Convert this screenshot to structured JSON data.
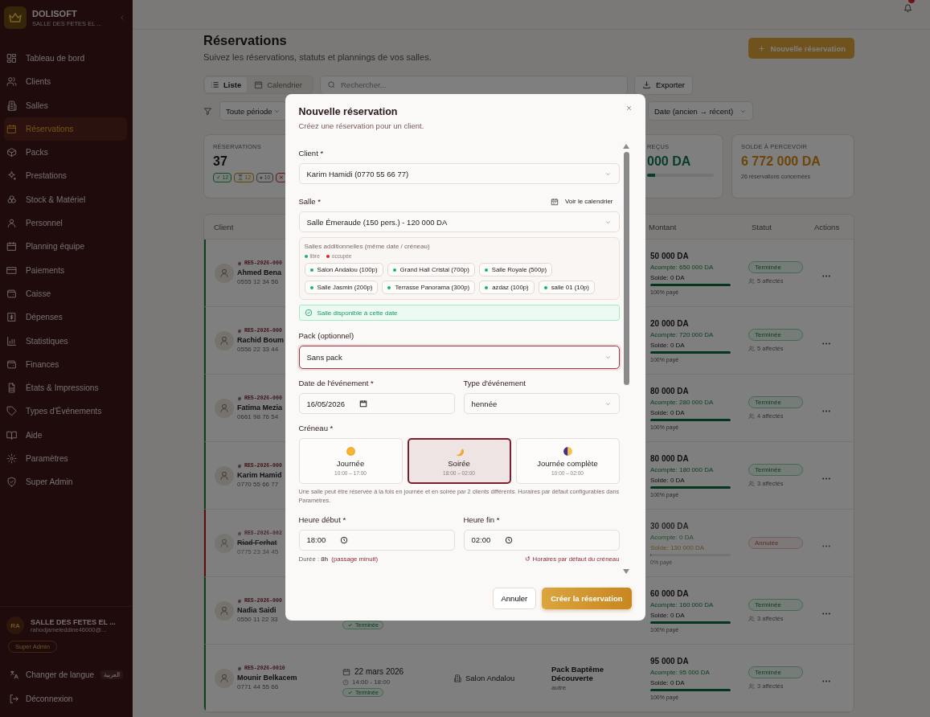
{
  "sidebar": {
    "brand": "DOLISOFT",
    "venue": "SALLE DES FETES EL ...",
    "items": [
      {
        "label": "Tableau de bord",
        "selected": false
      },
      {
        "label": "Clients",
        "selected": false
      },
      {
        "label": "Salles",
        "selected": false
      },
      {
        "label": "Réservations",
        "selected": true
      },
      {
        "label": "Packs",
        "selected": false
      },
      {
        "label": "Prestations",
        "selected": false
      },
      {
        "label": "Stock & Matériel",
        "selected": false
      },
      {
        "label": "Personnel",
        "selected": false
      },
      {
        "label": "Planning équipe",
        "selected": false
      },
      {
        "label": "Paiements",
        "selected": false
      },
      {
        "label": "Caisse",
        "selected": false
      },
      {
        "label": "Dépenses",
        "selected": false
      },
      {
        "label": "Statistiques",
        "selected": false
      },
      {
        "label": "Finances",
        "selected": false
      },
      {
        "label": "États & Impressions",
        "selected": false
      },
      {
        "label": "Types d'Événements",
        "selected": false
      },
      {
        "label": "Aide",
        "selected": false
      },
      {
        "label": "Paramètres",
        "selected": false
      },
      {
        "label": "Super Admin",
        "selected": false
      }
    ],
    "user": {
      "initials": "RA",
      "name": "SALLE DES FETES EL ...",
      "email": "rahodjameleddine46000@...",
      "role": "Super Admin"
    },
    "language": {
      "label": "Changer de langue",
      "value": "العربية"
    },
    "logout": "Déconnexion"
  },
  "topbar": {
    "unread": true
  },
  "page": {
    "title": "Réservations",
    "subtitle": "Suivez les réservations, statuts et plannings de vos salles.",
    "new_button": "Nouvelle réservation"
  },
  "view_tabs": [
    {
      "label": "Liste",
      "selected": true
    },
    {
      "label": "Calendrier",
      "selected": false
    }
  ],
  "search": {
    "placeholder": "Rechercher..."
  },
  "export": "Exporter",
  "filters": [
    "Toute période",
    "Date (ancien → récent)"
  ],
  "stats": [
    {
      "kind": "count",
      "label": "RÉSERVATIONS",
      "value": "37",
      "chips": [
        {
          "text": "✓ 12",
          "kind": "done"
        },
        {
          "text": "⌛ 12",
          "kind": "pending"
        },
        {
          "text": "● 10",
          "kind": "other"
        },
        {
          "text": "✕",
          "kind": "cancelled"
        }
      ]
    },
    {
      "kind": "money",
      "label": "REÇUS",
      "value": "000 DA",
      "level": 0.12
    },
    {
      "kind": "balance",
      "label": "SOLDE À PERCEVOIR",
      "value": "6 772 000 DA",
      "note": "26 réservations concernées"
    }
  ],
  "table": {
    "columns": [
      "Client",
      "Montant",
      "Statut",
      "Actions"
    ],
    "rows": [
      {
        "ref": "RES-2026-000",
        "name": "Ahmed Bena",
        "phone": "0555 12 34 56",
        "amount": "50 000 DA",
        "deposit": "Acompte: 650 000 DA",
        "balance": "Solde: 0 DA",
        "level": 1,
        "paid": "100% payé",
        "status": "Terminée",
        "staff": "5 affectés",
        "cancelled": false
      },
      {
        "ref": "RES-2026-000",
        "name": "Rachid Boum",
        "phone": "0556 22 33 44",
        "amount": "20 000 DA",
        "deposit": "Acompte: 720 000 DA",
        "balance": "Solde: 0 DA",
        "level": 1,
        "paid": "100% payé",
        "status": "Terminée",
        "staff": "5 affectés",
        "cancelled": false
      },
      {
        "ref": "RES-2026-000",
        "name": "Fatima Mezia",
        "phone": "0661 98 76 54",
        "amount": "80 000 DA",
        "deposit": "Acompte: 280 000 DA",
        "balance": "Solde: 0 DA",
        "level": 1,
        "paid": "100% payé",
        "status": "Terminée",
        "staff": "4 affectés",
        "cancelled": false
      },
      {
        "ref": "RES-2026-000",
        "name": "Karim Hamid",
        "phone": "0770 55 66 77",
        "amount": "80 000 DA",
        "deposit": "Acompte: 180 000 DA",
        "balance": "Solde: 0 DA",
        "level": 1,
        "paid": "100% payé",
        "status": "Terminée",
        "staff": "3 affectés",
        "cancelled": false
      },
      {
        "ref": "RES-2026-002",
        "name": "Riad Ferhat",
        "phone": "0775 23 34 45",
        "amount": "30 000 DA",
        "deposit": "Acompte: 0 DA",
        "balance": "Solde: 130 000 DA",
        "level": 0,
        "paid": "0% payé",
        "status": "Annulée",
        "cancelled": true
      },
      {
        "ref": "RES-2026-000",
        "name": "Nadia Saidi",
        "phone": "0550 11 22 33",
        "date_status": "Terminée",
        "amount": "60 000 DA",
        "deposit": "Acompte: 160 000 DA",
        "balance": "Solde: 0 DA",
        "level": 1,
        "paid": "100% payé",
        "status": "Terminée",
        "staff": "3 affectés",
        "cancelled": false
      },
      {
        "ref": "RES-2026-0010",
        "name": "Mounir Belkacem",
        "phone": "0771 44 55 66",
        "date": "22 mars 2026",
        "time": "14:00 - 18:00",
        "date_status": "Terminée",
        "hall": "Salon Andalou",
        "pack": "Pack Baptême Découverte",
        "event_type": "autre",
        "amount": "95 000 DA",
        "deposit": "Acompte: 95 000 DA",
        "balance": "Solde: 0 DA",
        "level": 1,
        "paid": "100% payé",
        "status": "Terminée",
        "staff": "3 affectés",
        "cancelled": false
      }
    ]
  },
  "modal": {
    "title": "Nouvelle réservation",
    "subtitle": "Créez une réservation pour un client.",
    "client": {
      "label": "Client *",
      "value": "Karim Hamidi (0770 55 66 77)"
    },
    "hall": {
      "label": "Salle *",
      "link": "Voir le calendrier",
      "value": "Salle Émeraude (150 pers.) - 120 000 DA"
    },
    "extra_halls": {
      "title": "Salles additionnelles (même date / créneau)",
      "legend": [
        {
          "label": "libre",
          "color": "#16b56b"
        },
        {
          "label": "occupée",
          "color": "#e11d2a"
        }
      ],
      "items": [
        {
          "label": "Salon Andalou (100p)",
          "color": "#16b56b"
        },
        {
          "label": "Grand Hall Cristal (700p)",
          "color": "#16b56b"
        },
        {
          "label": "Salle Royale (500p)",
          "color": "#16b56b"
        },
        {
          "label": "Salle Jasmin (200p)",
          "color": "#16b56b"
        },
        {
          "label": "Terrasse Panorama (300p)",
          "color": "#16b56b"
        },
        {
          "label": "azdaz (100p)",
          "color": "#16b56b"
        },
        {
          "label": "salle 01 (10p)",
          "color": "#16b56b"
        }
      ]
    },
    "availability": "Salle disponible à cette date",
    "pack": {
      "label": "Pack (optionnel)",
      "value": "Sans pack",
      "focused": true
    },
    "date": {
      "label": "Date de l'événement *",
      "value": "16/05/2026"
    },
    "event_type": {
      "label": "Type d'événement",
      "value": "hennée"
    },
    "slot": {
      "label": "Créneau *",
      "options": [
        {
          "kind": "day",
          "title": "Journée",
          "hours": "10:00 – 17:00",
          "selected": false
        },
        {
          "kind": "evening",
          "title": "Soirée",
          "hours": "18:00 – 02:00",
          "selected": true
        },
        {
          "kind": "full",
          "title": "Journée complète",
          "hours": "10:00 – 02:00",
          "selected": false
        }
      ],
      "help": "Une salle peut être réservée à la fois en journée et en soirée par 2 clients différents. Horaires par défaut configurables dans Paramètres."
    },
    "start": {
      "label": "Heure début *",
      "value": "18:00"
    },
    "end": {
      "label": "Heure fin *",
      "value": "02:00"
    },
    "duration": "Durée : **8h**",
    "duration_note": "(passage minuit)",
    "reset": "↺ Horaires par défaut du créneau",
    "cancel": "Annuler",
    "submit": "Créer la réservation"
  }
}
